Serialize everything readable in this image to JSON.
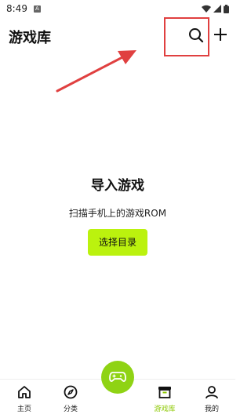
{
  "status_bar": {
    "time": "8:49",
    "a_badge": "A"
  },
  "header": {
    "title": "游戏库",
    "search_icon": "search-icon",
    "add_icon": "plus-icon"
  },
  "empty_state": {
    "title": "导入游戏",
    "subtitle": "扫描手机上的游戏ROM",
    "button_label": "选择目录"
  },
  "bottom_nav": {
    "items": [
      {
        "label": "主页",
        "icon": "home-icon",
        "active": false
      },
      {
        "label": "分类",
        "icon": "compass-icon",
        "active": false
      },
      {
        "label": "游戏库",
        "icon": "archive-box-icon",
        "active": true
      },
      {
        "label": "我的",
        "icon": "user-icon",
        "active": false
      }
    ],
    "fab_icon": "gamepad-icon"
  },
  "colors": {
    "accent": "#bbf20e",
    "fab": "#8fd314",
    "active_label": "#8cc800",
    "annotation": "#e04040"
  }
}
